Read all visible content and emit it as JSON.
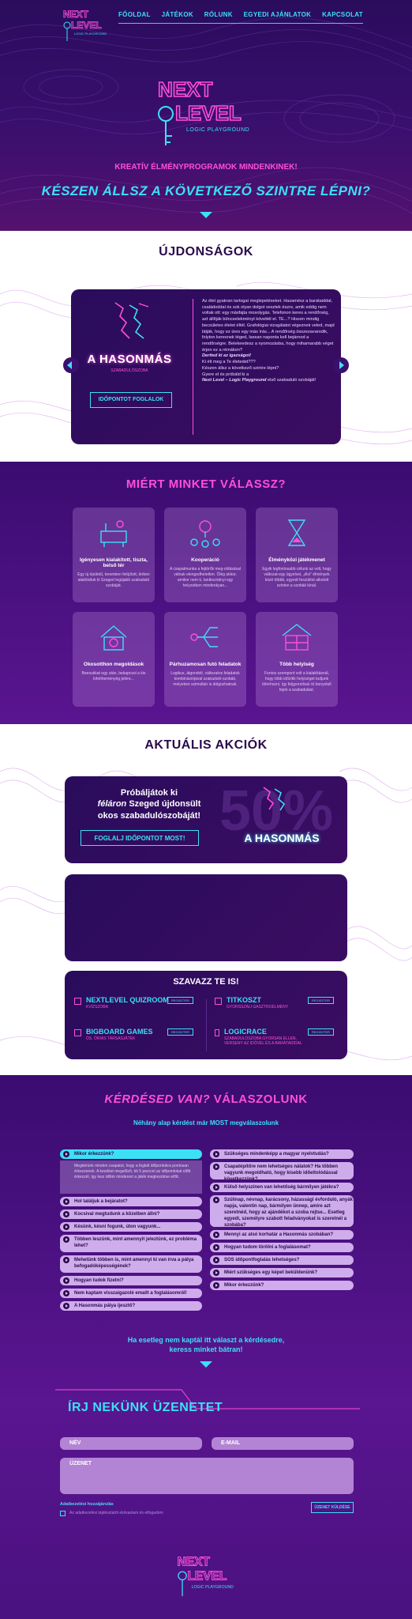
{
  "nav": {
    "items": [
      "FŐOLDAL",
      "JÁTÉKOK",
      "RÓLUNK",
      "EGYEDI AJÁNLATOK",
      "KAPCSOLAT"
    ]
  },
  "brand": {
    "line1": "NEXT",
    "line2": "LEVEL",
    "sub": "LOGIC PLAYGROUND"
  },
  "hero": {
    "tagline": "KREATÍV ÉLMÉNYPROGRAMOK MINDENKINEK!",
    "cta": "KÉSZEN ÁLLSZ A KÖVETKEZŐ SZINTRE LÉPNI?"
  },
  "news": {
    "title": "ÚJDONSÁGOK",
    "room_name": "A HASONMÁS",
    "room_sub": "SZABADULÓSZOBA",
    "book_button": "IDŐPONTOT FOGLALOK",
    "text": "Az élet gyakran tartogat meglepetéseket. Hazamész a barátaiddal, családoddal és sok olyan dolgot vesztek észre, amik eddig nem voltak ott: egy másfajta mosolygás. Telefonon keres a rendőrség, azt állítják bűncselekményt követtél el. TE...? Hiszen mindig becsületes életet éltél. Grafológiai vizsgálatot végeznek veled, majd látják, hogy ez üres egy más írás... A rendőrség összezavarodik, folyton keresnek téged, lassan naponta kell bejárnod a rendőrségre. Belekeedesz a nyomozásba, hogy mihamarabb véget érjen ez a rémálom?",
    "q1": "Deríted ki az igazságot!",
    "q2": "Ki élt meg a Te életedet???",
    "q3": "Készen állsz a következő szintre lépni?",
    "q4": "Gyere el és próbáld ki a",
    "q5": "Next Level – Logic Playground",
    "q6": "első szabaduló szobáját!"
  },
  "why": {
    "title": "MIÉRT MINKET VÁLASSZ?",
    "tiles": [
      {
        "title": "Igényesen kialakított, tiszta, belső tér",
        "desc": "Egy új épületű, teremben felújított, térben alakítottuk ki Szeged legújabb szabaduló szobáját."
      },
      {
        "title": "Kooperáció",
        "desc": "A csapatmunka a fejtörők meg-oldásával válnak elengedhetetlen. Ölég akkor, amikor nem ti, tantkozódnyi egy helyzetben mindenkyan..."
      },
      {
        "title": "Élményközi játékmenet",
        "desc": "Egyik legfontosabb célunk az volt, hogy változat-egy ügyelvei, „élvi\" élmények közé többb, egyedi feszülést alkotott szinten a szobák kínál."
      },
      {
        "title": "Okosotthon megoldások",
        "desc": "Beesukkat egy után, bekapcsol a kis kihétheményég jelére..."
      },
      {
        "title": "Párhuzamosan futó feladatok",
        "desc": "Logikus, átgondolt, változatos feladatok kombinációjával szabaduló-szobák, melyeken szimultán is dolgozhatnak."
      },
      {
        "title": "Több helyiség",
        "desc": "Fontos szempont volt a kialakításnál, hogy több időzítik helyiséget tudjunk létrehozni, így felgyorsítsuk tó bonyolult fejek a szabadulást."
      }
    ]
  },
  "offers": {
    "title": "AKTUÁLIS AKCIÓK",
    "promo_line1": "Próbáljátok ki",
    "promo_line2a": "féláron",
    "promo_line2b": " Szeged újdonsült",
    "promo_line3": "okos szabadulószobáját!",
    "promo_button": "FOGLALJ IDŐPONTOT MOST!",
    "promo_room": "A HASONMÁS",
    "promo_percent": "50%"
  },
  "vote": {
    "title": "SZAVAZZ TE IS!",
    "button": "REGISZTER",
    "options": [
      {
        "name": "NEXTLEVEL QUIZROOM",
        "sub": "KVÍZSZOBA"
      },
      {
        "name": "TITKOSZT",
        "sub": "GYORSSZÁLI GASZTROÉLMÉNY"
      },
      {
        "name": "BIGBOARD GAMES",
        "sub": "ÓS. ÓRIÁS TÁRSASJÁTÉK"
      },
      {
        "name": "LOGICRACE",
        "sub": "SZABADULÓSZOBA GYORSAN ELLEN, VERSENY AZ IDŐVEL ÉS A BARÁTAIDDAL"
      }
    ]
  },
  "faq": {
    "title_a": "KÉRDÉSED VAN?",
    "title_b": " VÁLASZOLUNK",
    "subtitle": "Néhány alap kérdést már MOST megválaszolunk",
    "open_question": "Mikor érkezzünk?",
    "open_answer": "Megkérünk minden csapatot, hogy a foglalt időpontokra pontosan érkezzenek. A kezdést megelőző, kb 5 perccel az időpontokat előtt érkezzél, így lesz időnk mindennri a játék megkezdése előtt.",
    "left": [
      "Hol találjuk a bejáratot?",
      "Kocsival megtudunk a közelben állni?",
      "Késünk, késni fogunk, úton vagyunk...",
      "Többen leszünk, mint amennyit jeleztünk, ez probléma lehet?",
      "Mehetünk többen is, mint amennyi ki van írva a pálya befogadóképességének?",
      "Hogyan tudok fizetni?",
      "Nem kaptam visszaigazolé emailt a foglalásomról!",
      "A Hasonmás pálya ijesztő?"
    ],
    "right": [
      "Szükséges mindenképp a magyar nyelvtudás?",
      "Csapatépítőre nem lehetséges nálatok? Ha többen vagyunk megoldható, hogy kisebb időeltolódással következzünk?",
      "Külső helyszínen van lehetőség bármilyen játékra?",
      "Szülinap, névnap, karácsony, házassági évforduló, anyák napja, valentin nap, bármilyen ünnep, amire azt szeretnéd, hogy az ajándékot a szoba rejtse... Esetleg egyedi, személyre szabott feladványokat is szeretnél a szobába?",
      "Mennyi az alsó korhatár a Hasonmás szobában?",
      "Hogyan tudom törölni a foglalásomat?",
      "SOS időpontfoglalás lehetséges?",
      "Miért szükséges egy képet beküldenünk?",
      "Mikor érkezzünk?"
    ],
    "footer_q": "Ha esetleg nem kaptál itt választ a kérdésedre,",
    "footer_q2": "keress minket bátran!"
  },
  "contact": {
    "title": "ÍRJ NEKÜNK ÜZENETET",
    "name_placeholder": "NÉV",
    "email_placeholder": "E-MAIL",
    "message_placeholder": "ÜZENET",
    "privacy_title": "Adatkezelési hozzájárulás",
    "privacy_text": "Az adatkezelési tájékoztatót elolvastam és elfogadom",
    "send_button": "ÜZENET KÜLDÉSE"
  }
}
